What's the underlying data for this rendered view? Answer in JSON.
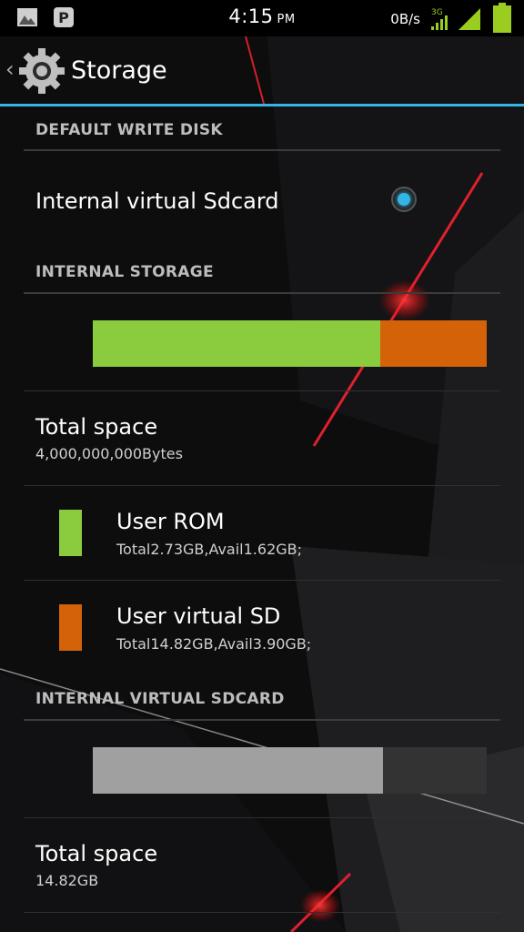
{
  "status_bar": {
    "time": "4:15",
    "ampm": "PM",
    "net_speed": "0B/s",
    "network_type": "3G",
    "icons": [
      "gallery-icon",
      "pinterest-icon",
      "signal-icon",
      "battery-icon"
    ]
  },
  "action_bar": {
    "title": "Storage",
    "icon": "gear-icon",
    "accent_color": "#33b5e5"
  },
  "default_write_disk": {
    "header": "DEFAULT WRITE DISK",
    "option_label": "Internal virtual Sdcard",
    "selected": true
  },
  "internal_storage": {
    "header": "INTERNAL STORAGE",
    "usage_bar": [
      {
        "name": "User ROM",
        "fraction": 0.73,
        "color": "#8bcc3f"
      },
      {
        "name": "User virtual SD",
        "fraction": 0.27,
        "color": "#d36208"
      }
    ],
    "total_title": "Total space",
    "total_value": "4,000,000,000Bytes",
    "items": [
      {
        "label": "User ROM",
        "detail": "Total2.73GB,Avail1.62GB;",
        "color": "#8bcc3f"
      },
      {
        "label": "User virtual SD",
        "detail": "Total14.82GB,Avail3.90GB;",
        "color": "#d36208"
      }
    ]
  },
  "internal_virtual_sdcard": {
    "header": "INTERNAL VIRTUAL SDCARD",
    "usage_bar": [
      {
        "name": "used",
        "fraction": 0.737,
        "color": "#a0a0a0"
      },
      {
        "name": "free",
        "fraction": 0.263,
        "color": "#333333"
      }
    ],
    "total_title": "Total space",
    "total_value": "14.82GB"
  }
}
